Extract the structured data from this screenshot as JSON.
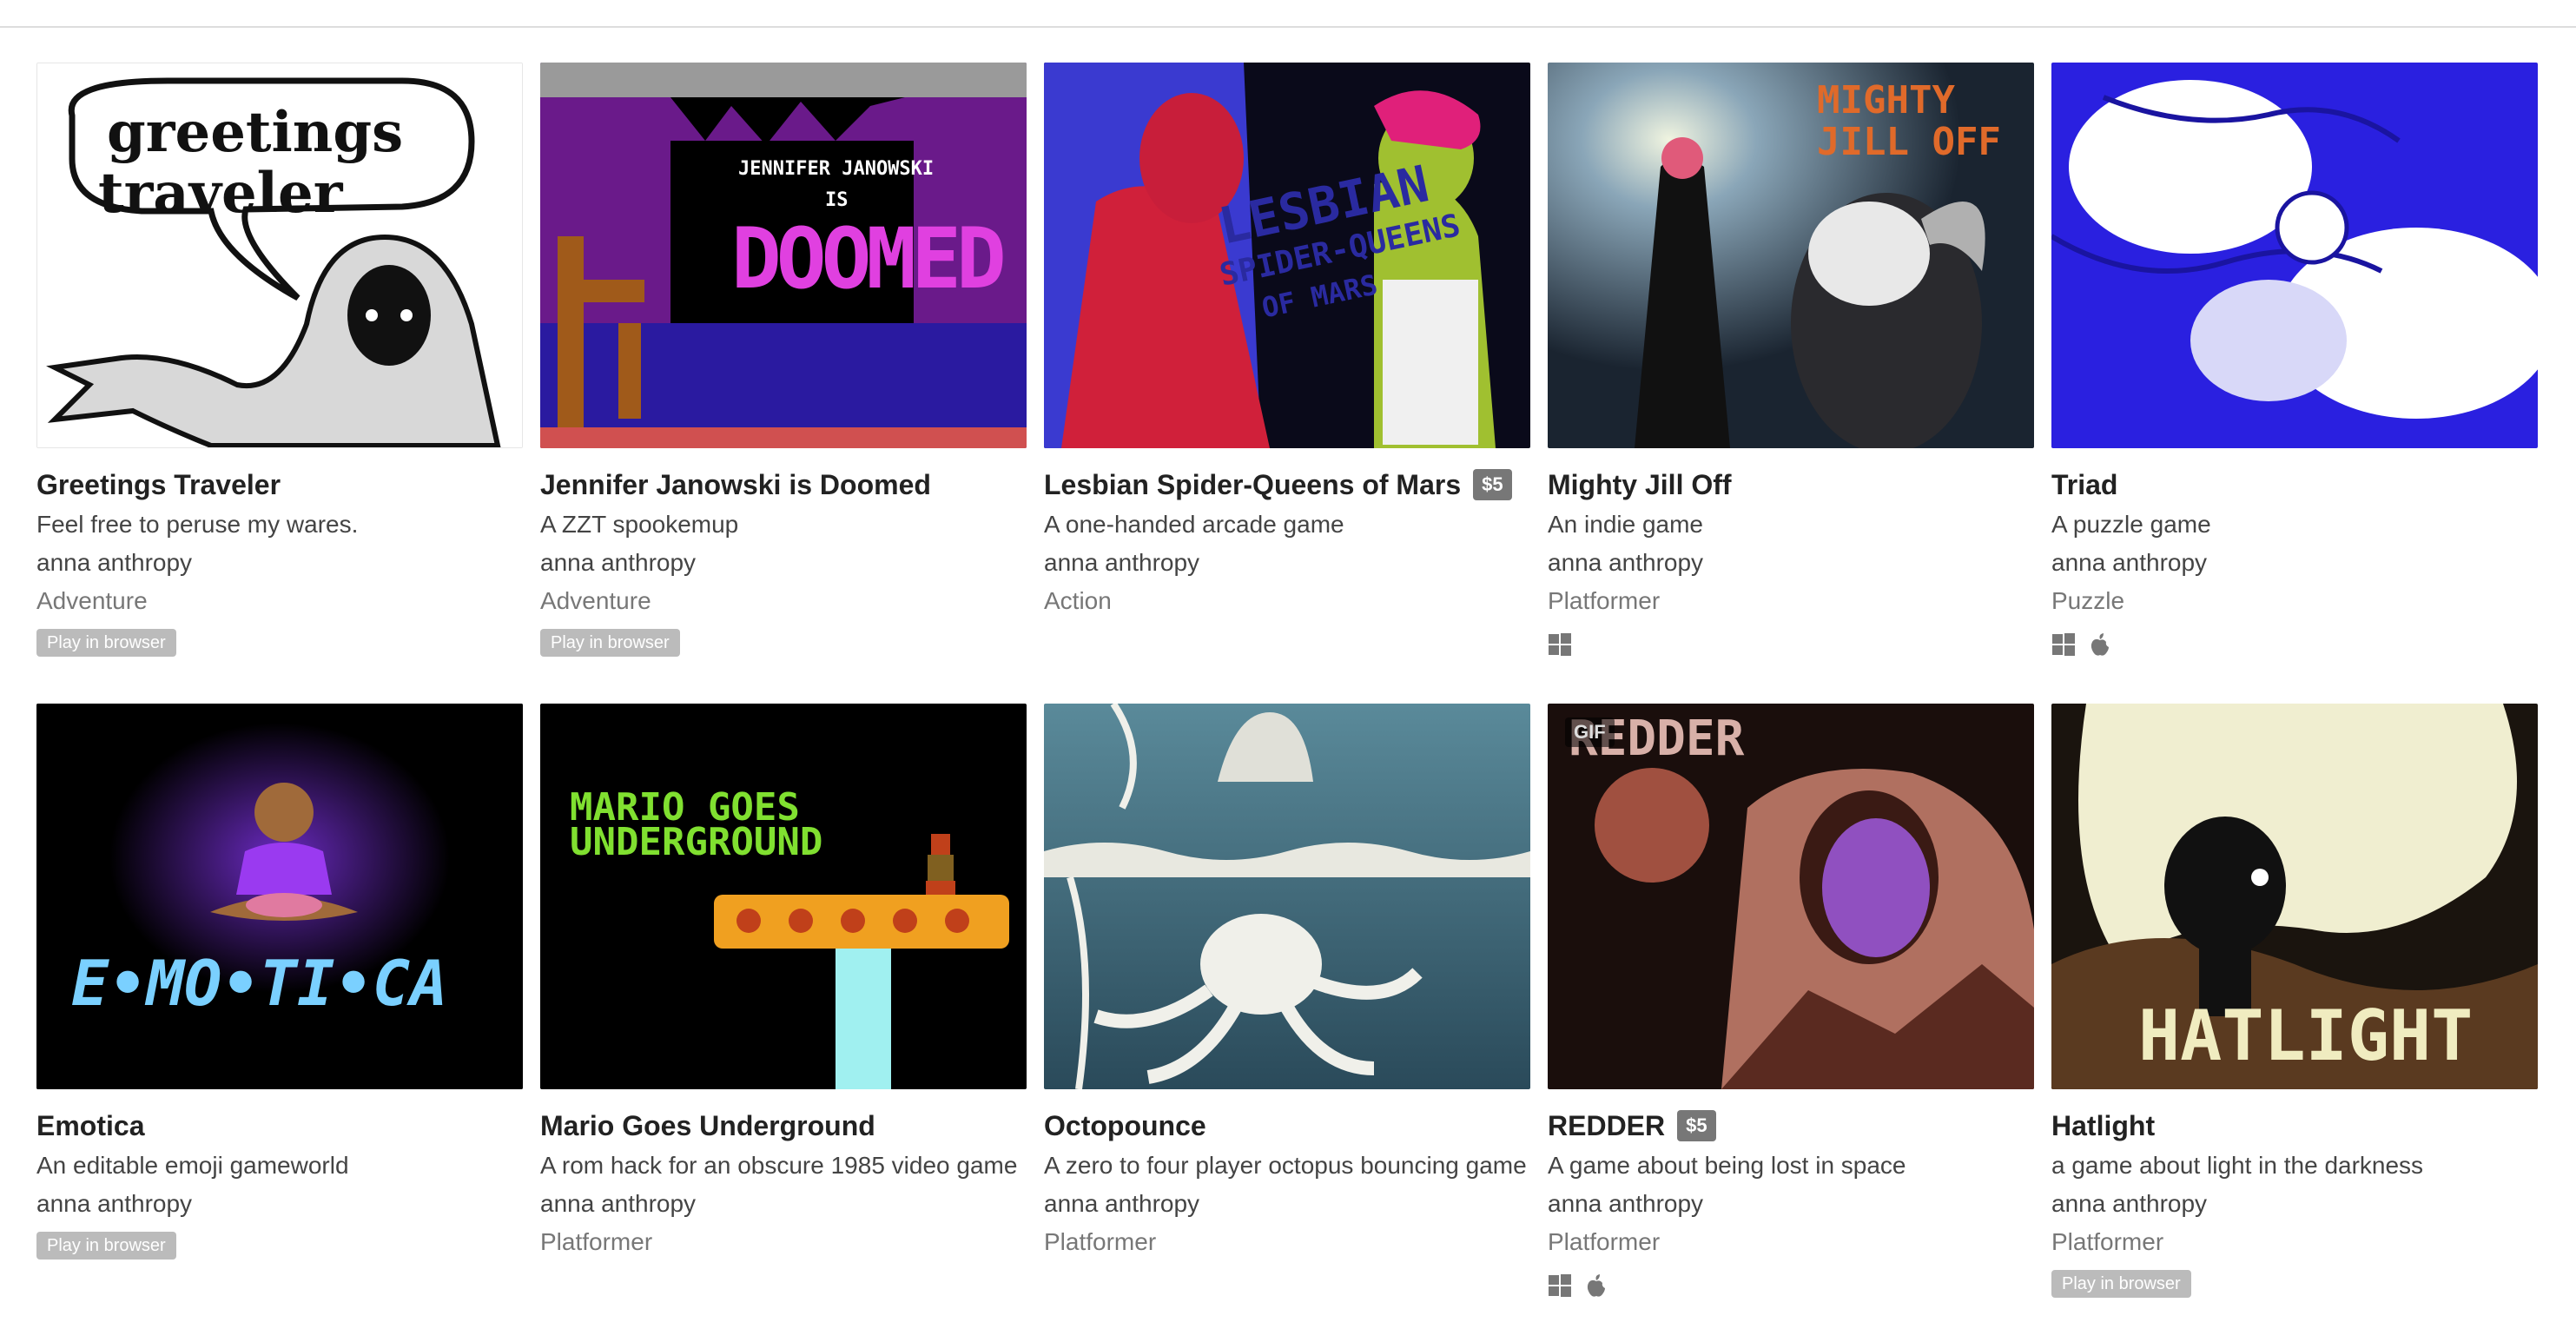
{
  "colors": {
    "title": "#222222",
    "text": "#444444",
    "muted": "#777777",
    "price_bg": "#777777",
    "badge_bg": "#bbbbbb"
  },
  "games": [
    {
      "title": "Greetings Traveler",
      "price": "",
      "description": "Feel free to peruse my wares.",
      "author": "anna anthropy",
      "genre": "Adventure",
      "badge": "Play in browser",
      "platforms": [],
      "thumb_text": [
        "greetings",
        "traveler"
      ]
    },
    {
      "title": "Jennifer Janowski is Doomed",
      "price": "",
      "description": "A ZZT spookemup",
      "author": "anna anthropy",
      "genre": "Adventure",
      "badge": "Play in browser",
      "platforms": [],
      "thumb_text": [
        "JENNIFER JANOWSKI",
        "IS",
        "DOOMED"
      ]
    },
    {
      "title": "Lesbian Spider-Queens of Mars",
      "price": "$5",
      "description": "A one-handed arcade game",
      "author": "anna anthropy",
      "genre": "Action",
      "badge": "",
      "platforms": [],
      "thumb_text": [
        "LESBIAN",
        "SPIDER-QUEENS",
        "OF MARS"
      ]
    },
    {
      "title": "Mighty Jill Off",
      "price": "",
      "description": "An indie game",
      "author": "anna anthropy",
      "genre": "Platformer",
      "badge": "",
      "platforms": [
        "windows-icon"
      ],
      "thumb_text": [
        "MIGHTY",
        "JILL OFF"
      ]
    },
    {
      "title": "Triad",
      "price": "",
      "description": "A puzzle game",
      "author": "anna anthropy",
      "genre": "Puzzle",
      "badge": "",
      "platforms": [
        "windows-icon",
        "apple-icon"
      ],
      "thumb_text": []
    },
    {
      "title": "Emotica",
      "price": "",
      "description": "An editable emoji gameworld",
      "author": "anna anthropy",
      "genre": "",
      "badge": "Play in browser",
      "platforms": [],
      "thumb_text": [
        "E•MO•TI•CA"
      ]
    },
    {
      "title": "Mario Goes Underground",
      "price": "",
      "description": "A rom hack for an obscure 1985 video game",
      "author": "anna anthropy",
      "genre": "Platformer",
      "badge": "",
      "platforms": [],
      "thumb_text": [
        "MARIO   GOES",
        "UNDERGROUND"
      ]
    },
    {
      "title": "Octopounce",
      "price": "",
      "description": "A zero to four player octopus bouncing game",
      "author": "anna anthropy",
      "genre": "Platformer",
      "badge": "",
      "platforms": [],
      "thumb_text": []
    },
    {
      "title": "REDDER",
      "price": "$5",
      "description": "A game about being lost in space",
      "author": "anna anthropy",
      "genre": "Platformer",
      "badge": "",
      "platforms": [
        "windows-icon",
        "apple-icon"
      ],
      "thumb_text": [
        "REDDER"
      ],
      "gif_label": "GIF"
    },
    {
      "title": "Hatlight",
      "price": "",
      "description": "a game about light in the darkness",
      "author": "anna anthropy",
      "genre": "Platformer",
      "badge": "Play in browser",
      "platforms": [],
      "thumb_text": [
        "HATLIGHT"
      ]
    }
  ]
}
